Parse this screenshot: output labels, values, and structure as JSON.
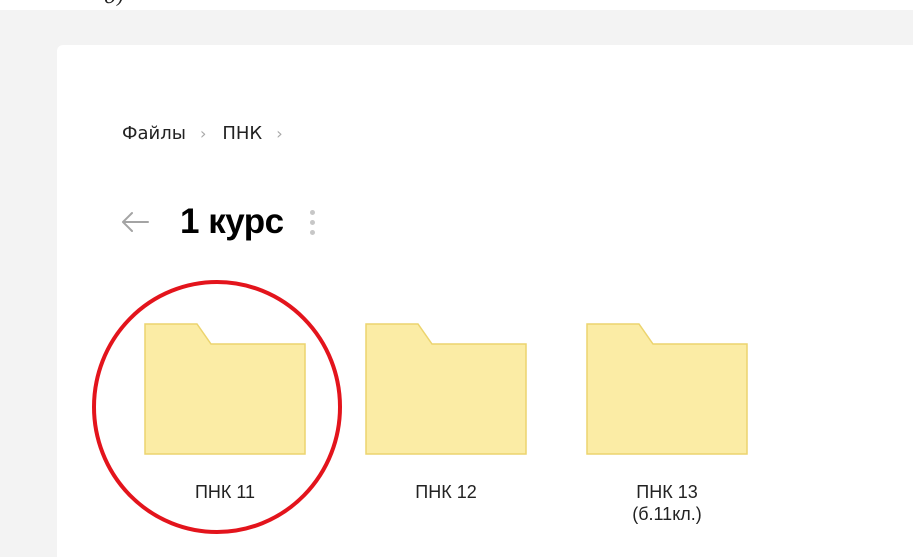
{
  "page_fragment": "д)",
  "breadcrumb": {
    "items": [
      {
        "label": "Файлы"
      },
      {
        "label": "ПНК"
      }
    ],
    "separator": "›"
  },
  "header": {
    "back_icon": "arrow-left-icon",
    "title": "1 курс",
    "more_icon": "more-vertical-icon"
  },
  "folders": [
    {
      "label": "ПНК 11",
      "icon": "folder-icon"
    },
    {
      "label": "ПНК 12",
      "icon": "folder-icon"
    },
    {
      "label": "ПНК 13\n(б.11кл.)",
      "icon": "folder-icon"
    }
  ],
  "colors": {
    "folder_fill": "#fbeca5",
    "folder_stroke": "#ecd46e",
    "annotation": "#e3141c",
    "background": "#f3f3f3"
  }
}
